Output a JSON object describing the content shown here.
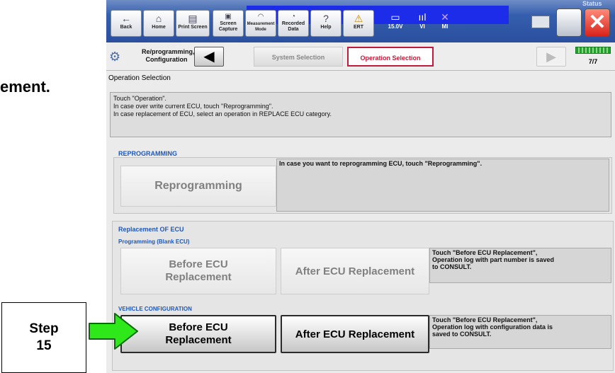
{
  "doc_fragment": "ement.",
  "status_label": "Status",
  "toolbar": {
    "back": {
      "icon": "←",
      "label": "Back"
    },
    "home": {
      "icon": "⌂",
      "label": "Home"
    },
    "print": {
      "icon": "▤",
      "label": "Print Screen"
    },
    "capture": {
      "icon": "▣",
      "label": "Screen\nCapture"
    },
    "measurement": {
      "icon": "◠",
      "label": "Measurement\nMode"
    },
    "recorded": {
      "icon": "◔",
      "label": "Recorded\nData"
    },
    "help": {
      "icon": "?",
      "label": "Help"
    },
    "ert": {
      "icon": "⚠",
      "label": "ERT"
    },
    "battery": {
      "icon": "▭",
      "label": "15.0V"
    },
    "vi": {
      "icon": "ııl",
      "label": "VI"
    },
    "mi": {
      "icon": "✕",
      "label": "MI"
    },
    "close_icon": "✕"
  },
  "nav": {
    "repro_label": "Re/programming,\nConfiguration",
    "back_arrow": "◀",
    "crumb_system": "System Selection",
    "crumb_operation": "Operation Selection",
    "forward_arrow": "▶",
    "page": "7/7"
  },
  "section_title": "Operation Selection",
  "instructions": [
    "Touch  \"Operation\".",
    "In case over write current ECU, touch  \"Reprogramming\".",
    "In case replacement of ECU, select an operation in REPLACE ECU category."
  ],
  "reprogramming": {
    "title": "REPROGRAMMING",
    "button": "Reprogramming",
    "desc": "In case you want to reprogramming ECU, touch \"Reprogramming\"."
  },
  "replacement": {
    "title": "Replacement OF ECU",
    "blank": {
      "title": "Programming (Blank ECU)",
      "before": "Before ECU\nReplacement",
      "after": "After ECU Replacement",
      "desc": [
        "Touch \"Before ECU Replacement\",",
        "Operation log with part number is saved",
        "to CONSULT."
      ]
    },
    "vehicle": {
      "title": "VEHICLE CONFIGURATION",
      "before": "Before ECU\nReplacement",
      "after": "After ECU Replacement",
      "desc": [
        "Touch \"Before ECU Replacement\",",
        "Operation log with configuration data is",
        "saved to CONSULT."
      ]
    }
  },
  "annotation": {
    "step_line1": "Step",
    "step_line2": "15",
    "arrow_color": "#2ee81a"
  }
}
